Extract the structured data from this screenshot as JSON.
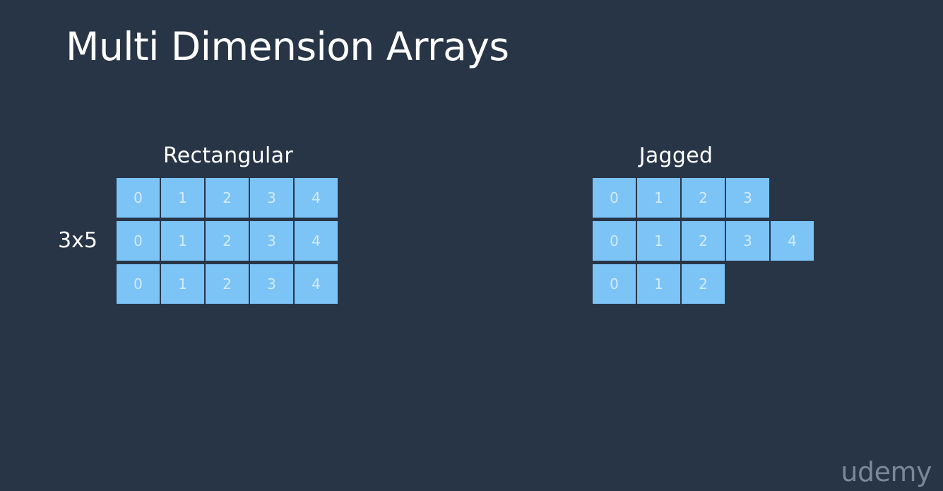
{
  "title": "Multi Dimension Arrays",
  "rectangular": {
    "label": "Rectangular",
    "dimension_label": "3x5",
    "rows": [
      [
        "0",
        "1",
        "2",
        "3",
        "4"
      ],
      [
        "0",
        "1",
        "2",
        "3",
        "4"
      ],
      [
        "0",
        "1",
        "2",
        "3",
        "4"
      ]
    ]
  },
  "jagged": {
    "label": "Jagged",
    "rows": [
      [
        "0",
        "1",
        "2",
        "3"
      ],
      [
        "0",
        "1",
        "2",
        "3",
        "4"
      ],
      [
        "0",
        "1",
        "2"
      ]
    ]
  },
  "watermark": "udemy",
  "colors": {
    "background": "#283546",
    "cell_fill": "#7cc3f6",
    "cell_text": "#d2ebfc",
    "text": "#ffffff",
    "watermark": "#7d8896"
  }
}
